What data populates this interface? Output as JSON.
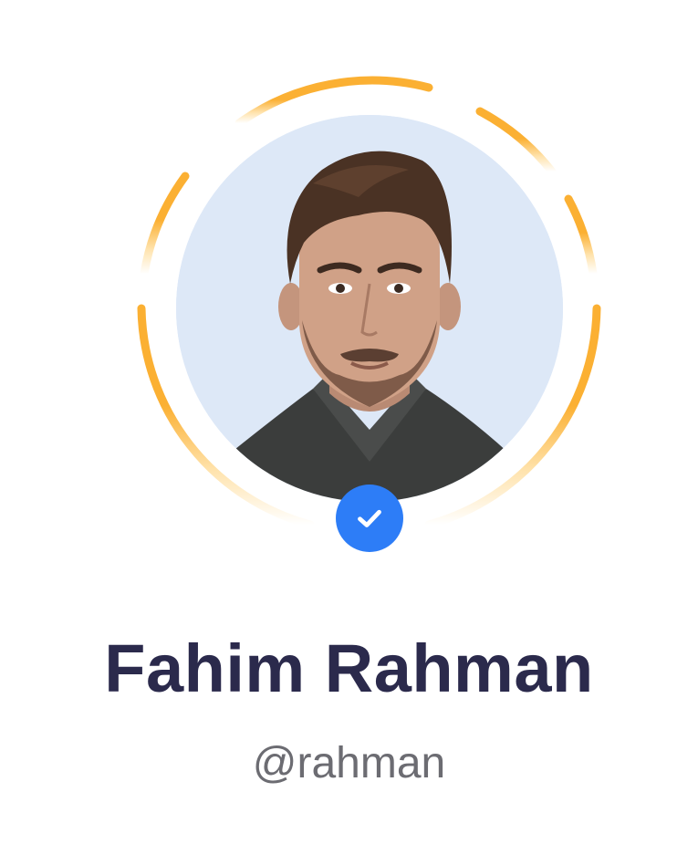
{
  "profile": {
    "name": "Fahim Rahman",
    "username": "@rahman",
    "verified": true
  },
  "icons": {
    "badge": "check-icon",
    "ring": "story-ring"
  },
  "colors": {
    "ring_primary": "#fbb033",
    "ring_faded": "#ffe3ad",
    "badge_bg": "#2d7df7",
    "avatar_bg": "#dde8f7",
    "name_text": "#2b2a4c",
    "username_text": "#6c6c72"
  }
}
